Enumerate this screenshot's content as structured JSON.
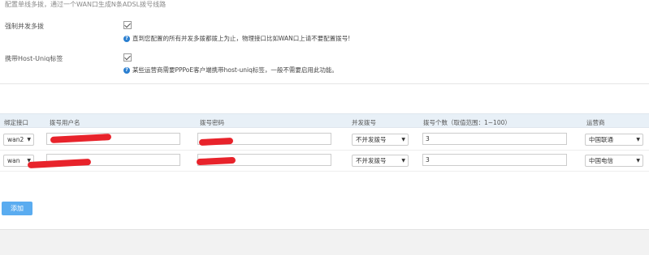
{
  "top_note": "配置单线多拨，通过一个WAN口生成N条ADSL拨号线路",
  "options": [
    {
      "label": "强制并发多拨",
      "checked": true,
      "help": "直到您配置的所有并发多拨都拨上为止，物理接口比如WAN口上请不要配置拨号!"
    },
    {
      "label": "携带Host-Uniq标签",
      "checked": true,
      "help": "某些运营商需要PPPoE客户端携带host-uniq标签，一般不需要启用此功能。"
    }
  ],
  "table": {
    "headers": [
      "绑定接口",
      "拨号用户名",
      "拨号密码",
      "并发拨号",
      "拨号个数（取值范围：1~100）",
      "运营商"
    ],
    "rows": [
      {
        "interface": "wan2",
        "username": "",
        "password": "",
        "concurrent": "不并发拨号",
        "count": "3",
        "isp": "中国联通"
      },
      {
        "interface": "wan",
        "username": "",
        "password": "",
        "concurrent": "不并发拨号",
        "count": "3",
        "isp": "中国电信"
      }
    ]
  },
  "add_button": "添加",
  "colors": {
    "accent": "#5aacf0",
    "help_icon": "#2a7fd0",
    "header_bg": "#e8f0f7",
    "redaction": "#e8232b"
  }
}
